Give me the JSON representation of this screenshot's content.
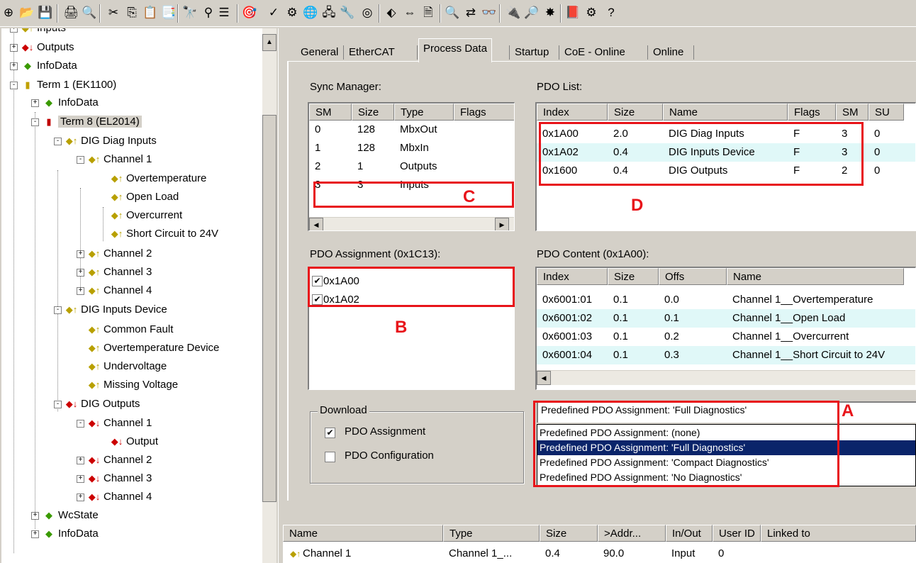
{
  "toolbar": {
    "icons": [
      "new-icon",
      "open-icon",
      "save-icon",
      "print-icon",
      "print-preview-icon",
      "cut-icon",
      "copy-icon",
      "paste-icon",
      "paste-with-links-icon",
      "find-icon",
      "replace-icon",
      "edit-icon",
      "target-icon",
      "activate-icon",
      "check-icon",
      "build-icon",
      "network-icon",
      "scan-icon",
      "devices-icon",
      "tools-icon",
      "target-browser-icon",
      "settings-icon",
      "list-icon",
      "zoom-icon",
      "toggle-icon",
      "online-icon",
      "scan-online-icon",
      "config-mode-icon",
      "book-icon",
      "gear-icon",
      "help-icon"
    ],
    "glyphs": [
      "⊕",
      "📂",
      "💾",
      "🖨",
      "🔍",
      "✂",
      "⎘",
      "📋",
      "📑",
      "🔭",
      "⚲",
      "☰",
      "🎯",
      "✓",
      "⚙",
      "🌐",
      "🖧",
      "🔧",
      "◎",
      "⬖",
      "⇔",
      "🗎",
      "🔍",
      "⇄",
      "👓",
      "🔌",
      "🔎",
      "✸",
      "📕",
      "⚙",
      "?"
    ]
  },
  "tree": {
    "nodes": [
      {
        "label": "Inputs",
        "icon": "◆↑",
        "color": "#b8a000"
      },
      {
        "label": "Outputs",
        "icon": "◆↓",
        "color": "#cc0000"
      },
      {
        "label": "InfoData",
        "icon": "◆",
        "color": "#3a9a00"
      },
      {
        "label": "Term 1 (EK1100)",
        "icon": "▮",
        "color": "#c0a000"
      },
      {
        "label": "InfoData",
        "icon": "◆",
        "color": "#3a9a00"
      },
      {
        "label": "Term 8 (EL2014)",
        "icon": "▮",
        "color": "#c00000"
      },
      {
        "label": "DIG Diag Inputs",
        "icon": "◆↑",
        "color": "#b8a000"
      },
      {
        "label": "Channel 1",
        "icon": "◆↑",
        "color": "#b8a000"
      },
      {
        "label": "Overtemperature",
        "icon": "◆↑",
        "color": "#b8a000"
      },
      {
        "label": "Open Load",
        "icon": "◆↑",
        "color": "#b8a000"
      },
      {
        "label": "Overcurrent",
        "icon": "◆↑",
        "color": "#b8a000"
      },
      {
        "label": "Short Circuit to 24V",
        "icon": "◆↑",
        "color": "#b8a000"
      },
      {
        "label": "Channel 2",
        "icon": "◆↑",
        "color": "#b8a000"
      },
      {
        "label": "Channel 3",
        "icon": "◆↑",
        "color": "#b8a000"
      },
      {
        "label": "Channel 4",
        "icon": "◆↑",
        "color": "#b8a000"
      },
      {
        "label": "DIG Inputs Device",
        "icon": "◆↑",
        "color": "#b8a000"
      },
      {
        "label": "Common Fault",
        "icon": "◆↑",
        "color": "#b8a000"
      },
      {
        "label": "Overtemperature Device",
        "icon": "◆↑",
        "color": "#b8a000"
      },
      {
        "label": "Undervoltage",
        "icon": "◆↑",
        "color": "#b8a000"
      },
      {
        "label": "Missing Voltage",
        "icon": "◆↑",
        "color": "#b8a000"
      },
      {
        "label": "DIG Outputs",
        "icon": "◆↓",
        "color": "#cc0000"
      },
      {
        "label": "Channel 1",
        "icon": "◆↓",
        "color": "#cc0000"
      },
      {
        "label": "Output",
        "icon": "◆↓",
        "color": "#cc0000"
      },
      {
        "label": "Channel 2",
        "icon": "◆↓",
        "color": "#cc0000"
      },
      {
        "label": "Channel 3",
        "icon": "◆↓",
        "color": "#cc0000"
      },
      {
        "label": "Channel 4",
        "icon": "◆↓",
        "color": "#cc0000"
      },
      {
        "label": "WcState",
        "icon": "◆",
        "color": "#3a9a00"
      },
      {
        "label": "InfoData",
        "icon": "◆",
        "color": "#3a9a00"
      }
    ]
  },
  "tabs": [
    "General",
    "EtherCAT",
    "Process Data",
    "Startup",
    "CoE - Online",
    "Online"
  ],
  "sync_manager": {
    "title": "Sync Manager:",
    "headers": [
      "SM",
      "Size",
      "Type",
      "Flags"
    ],
    "rows": [
      [
        "0",
        "128",
        "MbxOut",
        ""
      ],
      [
        "1",
        "128",
        "MbxIn",
        ""
      ],
      [
        "2",
        "1",
        "Outputs",
        ""
      ],
      [
        "3",
        "3",
        "Inputs",
        ""
      ]
    ]
  },
  "pdo_list": {
    "title": "PDO List:",
    "headers": [
      "Index",
      "Size",
      "Name",
      "Flags",
      "SM",
      "SU"
    ],
    "rows": [
      [
        "0x1A00",
        "2.0",
        "DIG Diag Inputs",
        "F",
        "3",
        "0"
      ],
      [
        "0x1A02",
        "0.4",
        "DIG Inputs Device",
        "F",
        "3",
        "0"
      ],
      [
        "0x1600",
        "0.4",
        "DIG Outputs",
        "F",
        "2",
        "0"
      ]
    ]
  },
  "pdo_assignment": {
    "title": "PDO Assignment (0x1C13):",
    "items": [
      {
        "label": "0x1A00",
        "checked": "✔"
      },
      {
        "label": "0x1A02",
        "checked": "✔"
      }
    ]
  },
  "pdo_content": {
    "title": "PDO Content (0x1A00):",
    "headers": [
      "Index",
      "Size",
      "Offs",
      "Name"
    ],
    "rows": [
      [
        "0x6001:01",
        "0.1",
        "0.0",
        "Channel 1__Overtemperature"
      ],
      [
        "0x6001:02",
        "0.1",
        "0.1",
        "Channel 1__Open Load"
      ],
      [
        "0x6001:03",
        "0.1",
        "0.2",
        "Channel 1__Overcurrent"
      ],
      [
        "0x6001:04",
        "0.1",
        "0.3",
        "Channel 1__Short Circuit to 24V"
      ]
    ]
  },
  "download": {
    "title": "Download",
    "options": [
      {
        "label": "PDO Assignment",
        "checked": "✔"
      },
      {
        "label": "PDO Configuration",
        "checked": ""
      }
    ]
  },
  "predefined": {
    "current": "Predefined PDO Assignment: 'Full Diagnostics'",
    "options": [
      "Predefined PDO Assignment: (none)",
      "Predefined PDO Assignment: 'Full Diagnostics'",
      "Predefined PDO Assignment: 'Compact Diagnostics'",
      "Predefined PDO Assignment: 'No Diagnostics'"
    ],
    "selected_index": 1
  },
  "annotations": {
    "a": "A",
    "b": "B",
    "c": "C",
    "d": "D"
  },
  "variables": {
    "headers": [
      "Name",
      "Type",
      "Size",
      ">Addr...",
      "In/Out",
      "User ID",
      "Linked to"
    ],
    "row": [
      "Channel 1",
      "Channel 1_...",
      "0.4",
      "90.0",
      "Input",
      "0",
      ""
    ]
  },
  "colors": {
    "annotation": "#e8141a",
    "selection": "#0a246a",
    "alt_row": "#e0f8f8"
  }
}
